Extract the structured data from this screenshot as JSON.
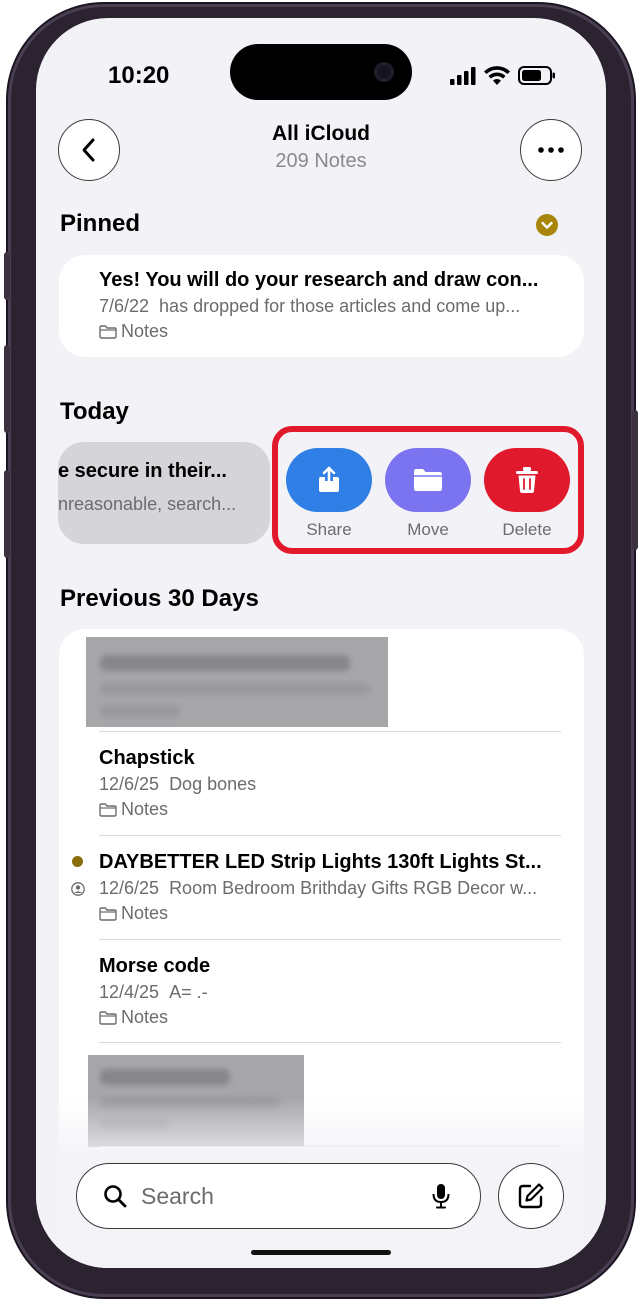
{
  "status": {
    "time": "10:20"
  },
  "nav": {
    "title": "All iCloud",
    "subtitle": "209 Notes"
  },
  "pinned": {
    "header": "Pinned",
    "notes": [
      {
        "title": "Yes! You will do your research and draw con...",
        "date": "7/6/22",
        "preview": "has dropped for those articles and come up...",
        "folder": "Notes"
      }
    ]
  },
  "today": {
    "header": "Today",
    "swiped_note": {
      "title": "e secure in their...",
      "preview": "nreasonable, search..."
    },
    "actions": {
      "share": "Share",
      "move": "Move",
      "delete": "Delete"
    }
  },
  "previous": {
    "header": "Previous 30 Days",
    "notes": [
      {
        "title": "Chapstick",
        "date": "12/6/25",
        "preview": "Dog bones",
        "folder": "Notes"
      },
      {
        "title": "DAYBETTER LED Strip Lights 130ft Lights St...",
        "date": "12/6/25",
        "preview": "Room Bedroom Brithday Gifts RGB Decor w...",
        "folder": "Notes",
        "shared": true
      },
      {
        "title": "Morse code",
        "date": "12/4/25",
        "preview": "A= .-",
        "folder": "Notes"
      }
    ]
  },
  "search": {
    "placeholder": "Search"
  },
  "colors": {
    "accent": "#8a6d0b",
    "share": "#2f7fe6",
    "move": "#7b74f0",
    "delete": "#e0192d",
    "highlight": "#e0192d"
  },
  "icons": [
    "chevron-left-icon",
    "ellipsis-icon",
    "chevron-down-circle-icon",
    "folder-icon",
    "share-icon",
    "trash-icon",
    "shared-person-icon",
    "search-icon",
    "mic-icon",
    "compose-icon"
  ]
}
